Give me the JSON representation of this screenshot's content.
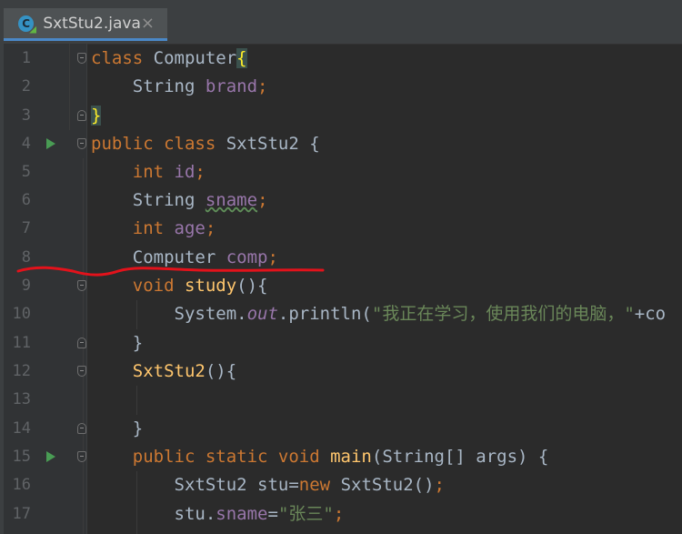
{
  "tab": {
    "title": "SxtStu2.java",
    "close_icon": "×",
    "file_icon": "java-class-icon"
  },
  "lines": [
    {
      "n": "1"
    },
    {
      "n": "2"
    },
    {
      "n": "3"
    },
    {
      "n": "4"
    },
    {
      "n": "5"
    },
    {
      "n": "6"
    },
    {
      "n": "7"
    },
    {
      "n": "8"
    },
    {
      "n": "9"
    },
    {
      "n": "10"
    },
    {
      "n": "11"
    },
    {
      "n": "12"
    },
    {
      "n": "13"
    },
    {
      "n": "14"
    },
    {
      "n": "15"
    },
    {
      "n": "16"
    },
    {
      "n": "17"
    }
  ],
  "code": {
    "l1_kw": "class",
    "l1_name": " Computer",
    "l1_brace": "{",
    "l2_type": "String",
    "l2_field": " brand",
    "l2_semi": ";",
    "l3_brace": "}",
    "l4_kw": "public class",
    "l4_name": " SxtStu2 {",
    "l5_kw": "int",
    "l5_field": " id",
    "l5_semi": ";",
    "l6_type": "String",
    "l6_field": "sname",
    "l6_semi": ";",
    "l7_kw": "int",
    "l7_field": " age",
    "l7_semi": ";",
    "l8_type": "Computer",
    "l8_field": " comp",
    "l8_semi": ";",
    "l9_kw": "void",
    "l9_method": " study",
    "l9_rest": "(){",
    "l10_sys": "System.",
    "l10_out": "out",
    "l10_print": ".println(",
    "l10_str": "\"我正在学习，使用我们的电脑，\"",
    "l10_rest": "+co",
    "l11_brace": "}",
    "l12_method": "SxtStu2",
    "l12_rest": "(){",
    "l14_brace": "}",
    "l15_kw": "public static void",
    "l15_method": " main",
    "l15_rest": "(String[] args) {",
    "l16_a": "SxtStu2 stu=",
    "l16_kw": "new",
    "l16_b": " SxtStu2()",
    "l16_semi": ";",
    "l17_a": "stu.",
    "l17_field": "sname",
    "l17_eq": "=",
    "l17_str": "\"张三\"",
    "l17_semi": ";"
  }
}
